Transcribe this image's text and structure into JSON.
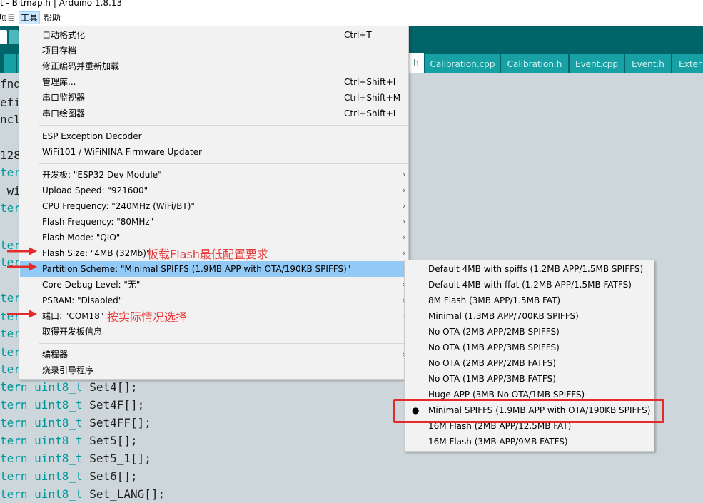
{
  "window": {
    "title": "t - Bitmap.h | Arduino 1.8.13"
  },
  "menubar": [
    "项目",
    "工具",
    "帮助"
  ],
  "tabs": [
    "h",
    "Calibration.cpp",
    "Calibration.h",
    "Event.cpp",
    "Event.h",
    "Exter"
  ],
  "tabs_left": [
    "B"
  ],
  "code_lines": [
    "fnd",
    "efi",
    "ncl",
    "",
    "128",
    "ter",
    " wi",
    "ter",
    "",
    "ter",
    "ter",
    "",
    "ter",
    "ter",
    "ter",
    "ter",
    "ter",
    "ter",
    "tern uint8_t Set4[];",
    "tern uint8_t Set4F[];",
    "tern uint8_t Set4FF[];",
    "tern uint8_t Set5[];",
    "tern uint8_t Set5_1[];",
    "tern uint8_t Set6[];",
    "tern uint8_t Set_LANG[];"
  ],
  "tools_menu": {
    "items": [
      {
        "label": "自动格式化",
        "shortcut": "Ctrl+T"
      },
      {
        "label": "项目存档",
        "shortcut": ""
      },
      {
        "label": "修正编码并重新加载",
        "shortcut": ""
      },
      {
        "label": "管理库...",
        "shortcut": "Ctrl+Shift+I"
      },
      {
        "label": "串口监视器",
        "shortcut": "Ctrl+Shift+M"
      },
      {
        "label": "串口绘图器",
        "shortcut": "Ctrl+Shift+L"
      },
      {
        "label": "ESP Exception Decoder",
        "shortcut": ""
      },
      {
        "label": "WiFi101 / WiFiNINA Firmware Updater",
        "shortcut": ""
      },
      {
        "label": "开发板: \"ESP32 Dev Module\"",
        "shortcut": ""
      },
      {
        "label": "Upload Speed: \"921600\"",
        "shortcut": ""
      },
      {
        "label": "CPU Frequency: \"240MHz (WiFi/BT)\"",
        "shortcut": ""
      },
      {
        "label": "Flash Frequency: \"80MHz\"",
        "shortcut": ""
      },
      {
        "label": "Flash Mode: \"QIO\"",
        "shortcut": ""
      },
      {
        "label": "Flash Size: \"4MB (32Mb)\"",
        "shortcut": ""
      },
      {
        "label": "Partition Scheme: \"Minimal SPIFFS (1.9MB APP with OTA/190KB SPIFFS)\"",
        "shortcut": ""
      },
      {
        "label": "Core Debug Level: \"无\"",
        "shortcut": ""
      },
      {
        "label": "PSRAM: \"Disabled\"",
        "shortcut": ""
      },
      {
        "label": "端口: \"COM18\"",
        "shortcut": ""
      },
      {
        "label": "取得开发板信息",
        "shortcut": ""
      },
      {
        "label": "编程器",
        "shortcut": ""
      },
      {
        "label": "烧录引导程序",
        "shortcut": ""
      }
    ],
    "submenu_arrow": "›"
  },
  "partition_submenu": {
    "items": [
      "Default 4MB with spiffs (1.2MB APP/1.5MB SPIFFS)",
      "Default 4MB with ffat (1.2MB APP/1.5MB FATFS)",
      "8M Flash (3MB APP/1.5MB FAT)",
      "Minimal (1.3MB APP/700KB SPIFFS)",
      "No OTA (2MB APP/2MB SPIFFS)",
      "No OTA (1MB APP/3MB SPIFFS)",
      "No OTA (2MB APP/2MB FATFS)",
      "No OTA (1MB APP/3MB FATFS)",
      "Huge APP (3MB No OTA/1MB SPIFFS)",
      "Minimal SPIFFS (1.9MB APP with OTA/190KB SPIFFS)",
      "16M Flash (2MB APP/12.5MB FAT)",
      "16M Flash (3MB APP/9MB FATFS)"
    ],
    "selected_index": 9,
    "selected_marker": "●"
  },
  "annotations": {
    "flash_size_note": "板载Flash最低配置要求",
    "port_note": "按实际情况选择"
  },
  "colors": {
    "toolbar": "#006468",
    "tab": "#17a1a5",
    "highlight": "#91c9f7",
    "annotation": "#e63b3b"
  }
}
